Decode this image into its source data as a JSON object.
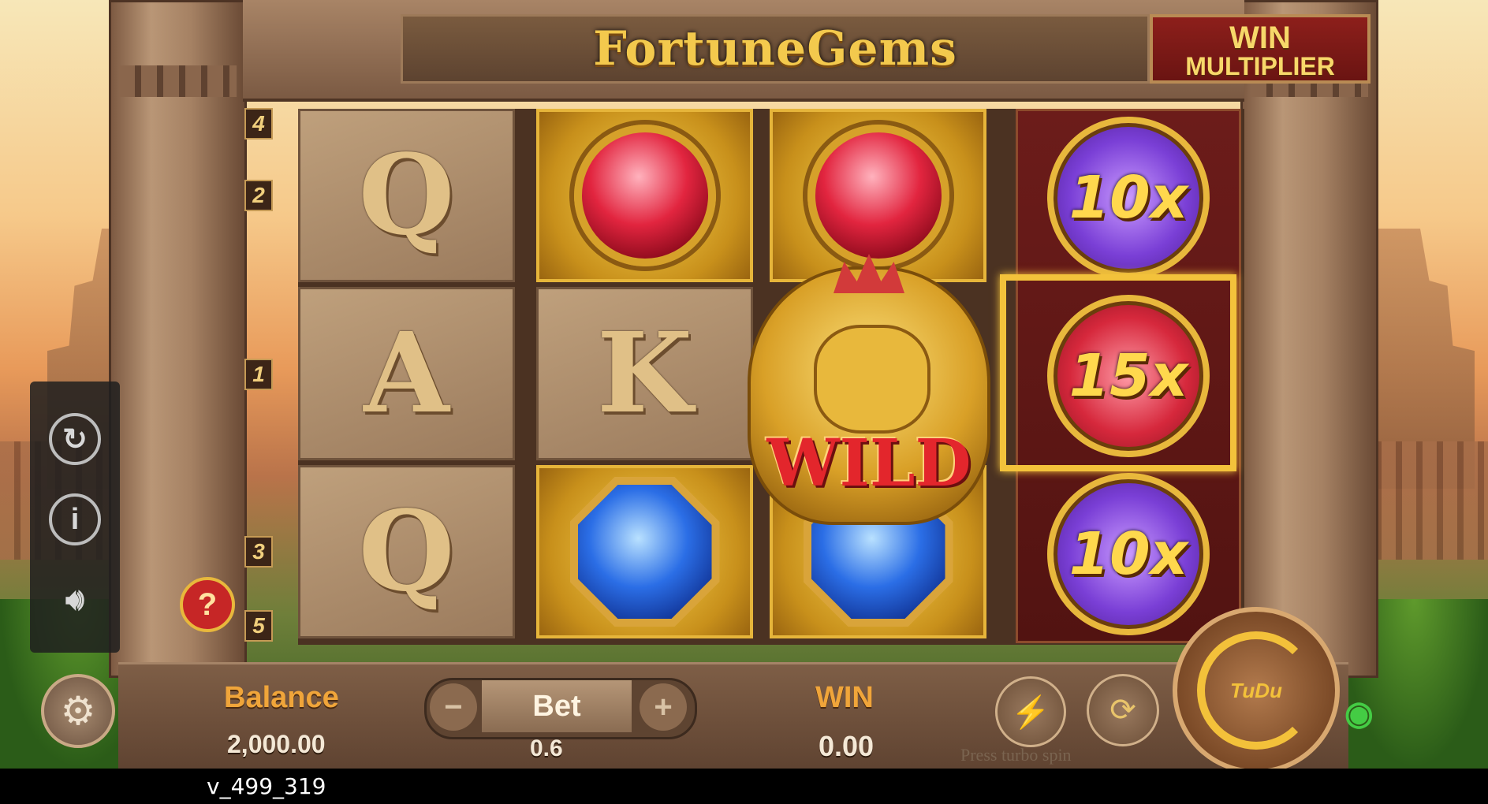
{
  "game": {
    "title": "FortuneGems",
    "win_multiplier_line1": "WIN",
    "win_multiplier_line2": "MULTIPLIER"
  },
  "paylines": [
    "4",
    "2",
    "1",
    "3",
    "5"
  ],
  "reels": [
    [
      "Q",
      "A",
      "Q"
    ],
    [
      "ruby",
      "K",
      "sapphire"
    ],
    [
      "ruby",
      "wild",
      "sapphire"
    ]
  ],
  "wild": {
    "label": "WILD"
  },
  "multipliers": [
    {
      "label": "10x",
      "color": "purple"
    },
    {
      "label": "15x",
      "color": "red",
      "highlighted": true
    },
    {
      "label": "10x",
      "color": "purple"
    }
  ],
  "bottom_bar": {
    "balance_label": "Balance",
    "balance_value": "2,000.00",
    "bet_label": "Bet",
    "bet_value": "0.6",
    "bet_minus": "−",
    "bet_plus": "+",
    "win_label": "WIN",
    "win_value": "0.00",
    "turbo_hint": "Press turbo spin",
    "spin_logo": "TuDu"
  },
  "icons": {
    "settings": "gear-icon",
    "turbo": "lightning-icon",
    "auto_spin": "autoplay-icon",
    "spin": "spin-icon",
    "connection": "wifi-icon",
    "replay": "replay-icon",
    "info": "info-icon",
    "sound": "speaker-icon",
    "help": "question-icon"
  },
  "side_panel": {
    "info_glyph": "i",
    "help_glyph": "?"
  },
  "footer": {
    "version": "v_499_319"
  },
  "colors": {
    "gold_label": "#f0a53a",
    "highlight": "#f3c23b",
    "wild_text": "#e3262c"
  }
}
